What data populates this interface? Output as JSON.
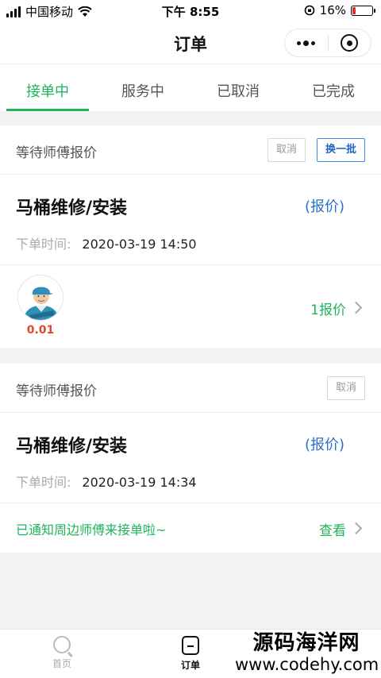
{
  "status_bar": {
    "carrier": "中国移动",
    "time": "下午 8:55",
    "battery_percent": "16%",
    "battery_level": 0.16
  },
  "nav": {
    "title": "订单"
  },
  "tabs": [
    {
      "label": "接单中",
      "active": true
    },
    {
      "label": "服务中",
      "active": false
    },
    {
      "label": "已取消",
      "active": false
    },
    {
      "label": "已完成",
      "active": false
    }
  ],
  "orders": [
    {
      "status_label": "等待师傅报价",
      "cancel_label": "取消",
      "refresh_label": "换一批",
      "title": "马桶维修/安装",
      "quote_label": "(报价)",
      "time_key": "下单时间:",
      "time_value": "2020-03-19 14:50",
      "master_price": "0.01",
      "quote_count": "1报价"
    },
    {
      "status_label": "等待师傅报价",
      "cancel_label": "取消",
      "title": "马桶维修/安装",
      "quote_label": "(报价)",
      "time_key": "下单时间:",
      "time_value": "2020-03-19 14:34",
      "notify_text": "已通知周边师傅来接单啦~",
      "view_label": "查看"
    }
  ],
  "tabbar": {
    "home_label": "首页",
    "order_label": "订单"
  },
  "watermark": {
    "name": "源码海洋网",
    "url": "www.codehy.com"
  },
  "colors": {
    "accent_green": "#1fb45a",
    "link_blue": "#2a6fcb",
    "price_red": "#e0482a"
  }
}
